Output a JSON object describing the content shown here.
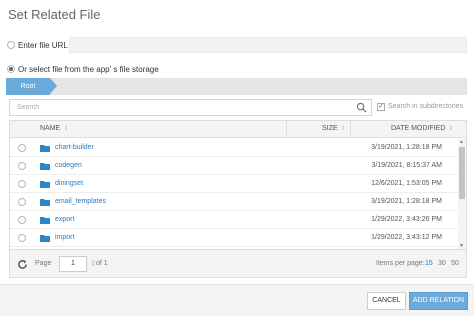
{
  "dialog": {
    "title": "Set Related File"
  },
  "options": {
    "url_label": "Enter file URL",
    "storage_label": "Or select file from the app' s file storage"
  },
  "breadcrumb": {
    "root": "Root"
  },
  "search": {
    "placeholder": "Search",
    "subdirs_label": "Search in subdirectories",
    "subdirs_checked": true
  },
  "table": {
    "headers": {
      "name": "NAME",
      "size": "SIZE",
      "date": "DATE MODIFIED"
    },
    "rows": [
      {
        "name": "chart-builder",
        "size": "",
        "date": "3/19/2021, 1:28:18 PM"
      },
      {
        "name": "codegen",
        "size": "",
        "date": "3/19/2021, 8:15:37 AM"
      },
      {
        "name": "diningset",
        "size": "",
        "date": "12/6/2021, 1:53:05 PM"
      },
      {
        "name": "email_templates",
        "size": "",
        "date": "3/19/2021, 1:28:18 PM"
      },
      {
        "name": "export",
        "size": "",
        "date": "1/29/2022, 3:43:26 PM"
      },
      {
        "name": "import",
        "size": "",
        "date": "1/29/2022, 3:43:12 PM"
      }
    ]
  },
  "pager": {
    "page_label": "Page",
    "page_value": "1",
    "of_label": "of 1",
    "items_label": "Items per page:",
    "sizes": [
      "15",
      "30",
      "50"
    ],
    "active_size": "15"
  },
  "footer": {
    "cancel_label": "CANCEL",
    "add_label": "ADD RELATION"
  },
  "colors": {
    "accent": "#6aabdb",
    "link": "#2a7bbf",
    "folder": "#2e86c8"
  }
}
